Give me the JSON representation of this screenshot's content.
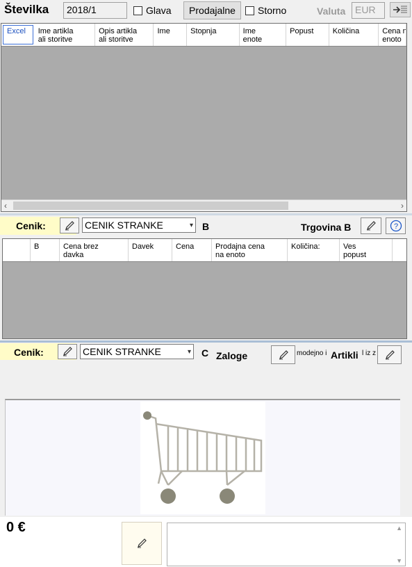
{
  "header": {
    "title": "Številka",
    "number_value": "2018/1",
    "glava_label": "Glava",
    "prodajalne_label": "Prodajalne",
    "storno_label": "Storno",
    "valuta_label": "Valuta",
    "valuta_value": "EUR"
  },
  "main_grid": {
    "columns": [
      "Excel",
      "Ime artikla ali storitve",
      "Opis artikla ali storitve",
      "Ime",
      "Stopnja",
      "Ime enote",
      "Popust",
      "Količina",
      "Cena na enoto"
    ],
    "columns_display": [
      [
        "Excel"
      ],
      [
        "Ime artikla",
        "ali storitve"
      ],
      [
        "Opis artikla",
        "ali storitve"
      ],
      [
        "Ime"
      ],
      [
        "Stopnja"
      ],
      [
        "Ime",
        "enote"
      ],
      [
        "Popust"
      ],
      [
        "Količina"
      ],
      [
        "Cena n",
        "enoto"
      ]
    ]
  },
  "section_b": {
    "cenik_label": "Cenik:",
    "cenik_value": "CENIK STRANKE",
    "letter": "B",
    "trgovina_label": "Trgovina B",
    "columns_display": [
      [
        "B"
      ],
      [
        "Cena brez",
        "davka"
      ],
      [
        "Davek"
      ],
      [
        "Cena"
      ],
      [
        "Prodajna cena",
        "na enoto"
      ],
      [
        "Količina:"
      ],
      [
        "Ves",
        "popust"
      ]
    ]
  },
  "section_c": {
    "cenik_label": "Cenik:",
    "cenik_value": "CENIK STRANKE",
    "letter": "C",
    "zaloge_label": "Zaloge",
    "modejno_label": "modejno i",
    "artikli_label": "Artikli",
    "iz_label": "l iz z"
  },
  "footer": {
    "total": "0 €"
  },
  "colors": {
    "yellow_bar": "#fffcc8",
    "grid_gray": "#ababab",
    "help_blue": "#1a56c8"
  }
}
